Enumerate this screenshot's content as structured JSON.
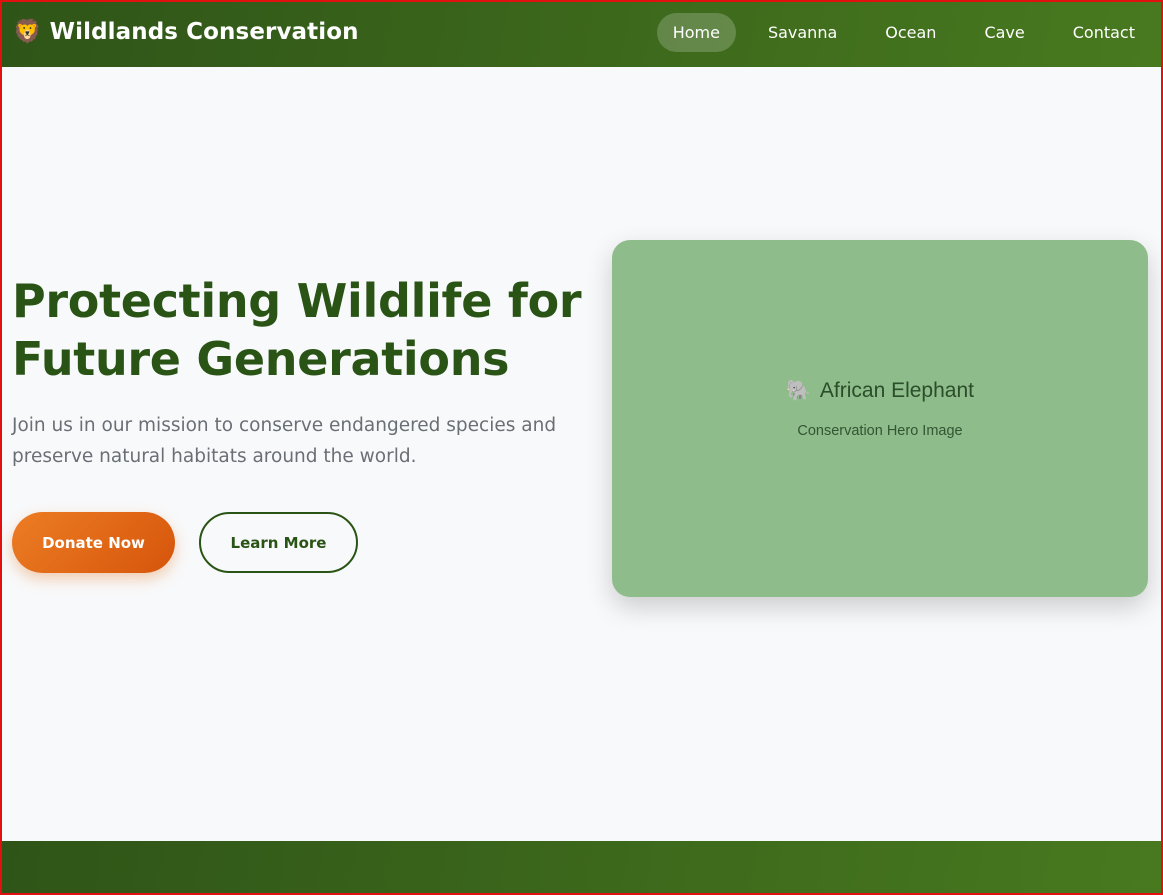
{
  "header": {
    "logo_icon": "🦁",
    "brand": "Wildlands Conservation",
    "nav": [
      {
        "label": "Home",
        "active": true
      },
      {
        "label": "Savanna",
        "active": false
      },
      {
        "label": "Ocean",
        "active": false
      },
      {
        "label": "Cave",
        "active": false
      },
      {
        "label": "Contact",
        "active": false
      }
    ]
  },
  "hero": {
    "title": "Protecting Wildlife for Future Generations",
    "subtitle": "Join us in our mission to conserve endangered species and preserve natural habitats around the world.",
    "donate_label": "Donate Now",
    "learn_label": "Learn More",
    "image": {
      "icon": "🐘",
      "label": "African Elephant",
      "caption": "Conservation Hero Image"
    }
  },
  "colors": {
    "header_green": "#3e6b1c",
    "title_green": "#2a5416",
    "donate_orange": "#e06a18",
    "image_bg": "#8fbc8b"
  }
}
